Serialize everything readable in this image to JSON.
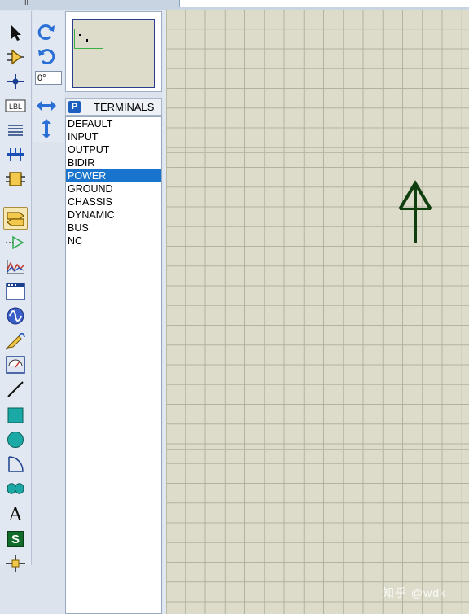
{
  "window": {
    "top_mark": "II"
  },
  "toolbar_left": {
    "tools": [
      {
        "id": "selection",
        "icon": "arrow-pointer-icon"
      },
      {
        "id": "component",
        "icon": "component-icon"
      },
      {
        "id": "junction",
        "icon": "junction-dot-icon"
      },
      {
        "id": "wire-label",
        "icon": "lbl-label-icon",
        "text": "LBL"
      },
      {
        "id": "text-script",
        "icon": "text-script-icon"
      },
      {
        "id": "buses",
        "icon": "bus-icon"
      },
      {
        "id": "subcircuit",
        "icon": "subcircuit-icon"
      },
      {
        "id": "terminals",
        "icon": "terminal-icon",
        "active": true
      },
      {
        "id": "device-pins",
        "icon": "device-pin-icon"
      },
      {
        "id": "graph",
        "icon": "graph-icon"
      },
      {
        "id": "tape-recorder",
        "icon": "tape-recorder-icon"
      },
      {
        "id": "generator",
        "icon": "generator-sine-icon"
      },
      {
        "id": "voltage-probe",
        "icon": "probe-icon"
      },
      {
        "id": "virtual-instruments",
        "icon": "meter-icon"
      },
      {
        "id": "2d-line",
        "icon": "line-icon"
      },
      {
        "id": "2d-box",
        "icon": "box-icon"
      },
      {
        "id": "2d-circle",
        "icon": "circle-icon"
      },
      {
        "id": "2d-arc",
        "icon": "arc-icon"
      },
      {
        "id": "2d-path",
        "icon": "path-icon"
      },
      {
        "id": "2d-text",
        "icon": "text-a-icon",
        "text": "A"
      },
      {
        "id": "2d-symbol",
        "icon": "symbol-s-icon",
        "text": "S"
      },
      {
        "id": "2d-marker",
        "icon": "marker-icon"
      }
    ]
  },
  "toolbar_rotate": {
    "rotate_cw_icon": "rotate-clockwise-icon",
    "rotate_ccw_icon": "rotate-counterclockwise-icon",
    "angle_value": "0°",
    "mirror_x_icon": "mirror-horizontal-icon",
    "mirror_y_icon": "mirror-vertical-icon"
  },
  "panel": {
    "mode_button": "P",
    "title": "TERMINALS",
    "items": [
      "DEFAULT",
      "INPUT",
      "OUTPUT",
      "BIDIR",
      "POWER",
      "GROUND",
      "CHASSIS",
      "DYNAMIC",
      "BUS",
      "NC"
    ],
    "selected": "POWER",
    "selected_color": "#1874cd"
  },
  "canvas": {
    "background_color": "#dddccb",
    "grid": "on",
    "placed_symbol": "power-terminal-arrow-icon",
    "symbol_color": "#0f3f0f"
  },
  "watermark": "知乎 @wdk"
}
